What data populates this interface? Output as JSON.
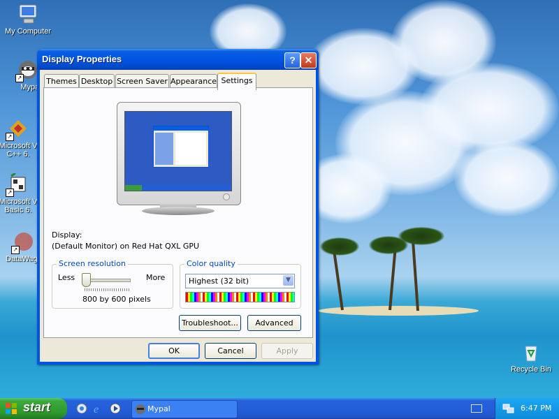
{
  "desktop": {
    "icons": [
      {
        "label": "My Computer"
      },
      {
        "label": "Mypal"
      },
      {
        "label": "Microsoft V",
        "label2": "C++ 6."
      },
      {
        "label": "Microsoft V",
        "label2": "Basic 6."
      },
      {
        "label": "DataWago"
      },
      {
        "label": "Recycle Bin"
      }
    ]
  },
  "window": {
    "title": "Display Properties",
    "help_glyph": "?",
    "close_glyph": "✕",
    "tabs": [
      "Themes",
      "Desktop",
      "Screen Saver",
      "Appearance",
      "Settings"
    ],
    "active_tab": "Settings",
    "display_label": "Display:",
    "display_value": "(Default Monitor) on Red Hat QXL GPU",
    "resolution": {
      "title": "Screen resolution",
      "less": "Less",
      "more": "More",
      "value_text": "800 by 600 pixels",
      "level": 0
    },
    "color": {
      "title": "Color quality",
      "selected": "Highest (32 bit)"
    },
    "buttons": {
      "troubleshoot": "Troubleshoot...",
      "advanced": "Advanced",
      "ok": "OK",
      "cancel": "Cancel",
      "apply": "Apply"
    }
  },
  "taskbar": {
    "start_label": "start",
    "task": "Mypal",
    "clock": "6:47 PM"
  }
}
